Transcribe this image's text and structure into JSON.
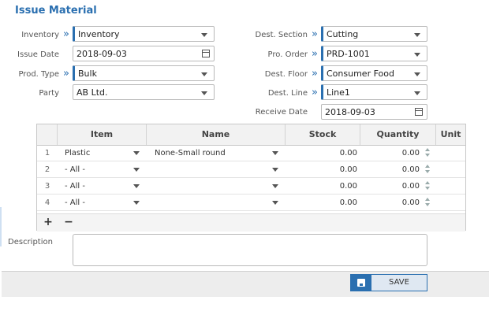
{
  "title": "Issue Material",
  "form": {
    "inventory_label": "Inventory",
    "inventory_value": "Inventory",
    "issue_date_label": "Issue Date",
    "issue_date_value": "2018-09-03",
    "prod_type_label": "Prod. Type",
    "prod_type_value": "Bulk",
    "party_label": "Party",
    "party_value": "AB Ltd.",
    "dest_section_label": "Dest. Section",
    "dest_section_value": "Cutting",
    "pro_order_label": "Pro. Order",
    "pro_order_value": "PRD-1001",
    "dest_floor_label": "Dest. Floor",
    "dest_floor_value": "Consumer Food",
    "dest_line_label": "Dest. Line",
    "dest_line_value": "Line1",
    "receive_date_label": "Receive Date",
    "receive_date_value": "2018-09-03",
    "chevron": "»"
  },
  "grid": {
    "columns": [
      "Item",
      "Name",
      "Stock",
      "Quantity",
      "Unit"
    ],
    "rows": [
      {
        "n": "1",
        "item": "Plastic",
        "name": "None-Small round",
        "stock": "0.00",
        "qty": "0.00",
        "unit": ""
      },
      {
        "n": "2",
        "item": "- All -",
        "name": "",
        "stock": "0.00",
        "qty": "0.00",
        "unit": ""
      },
      {
        "n": "3",
        "item": "- All -",
        "name": "",
        "stock": "0.00",
        "qty": "0.00",
        "unit": ""
      },
      {
        "n": "4",
        "item": "- All -",
        "name": "",
        "stock": "0.00",
        "qty": "0.00",
        "unit": ""
      }
    ],
    "add_label": "+",
    "remove_label": "−"
  },
  "description_label": "Description",
  "save_label": "SAVE",
  "colors": {
    "accent": "#2a6fb0"
  }
}
